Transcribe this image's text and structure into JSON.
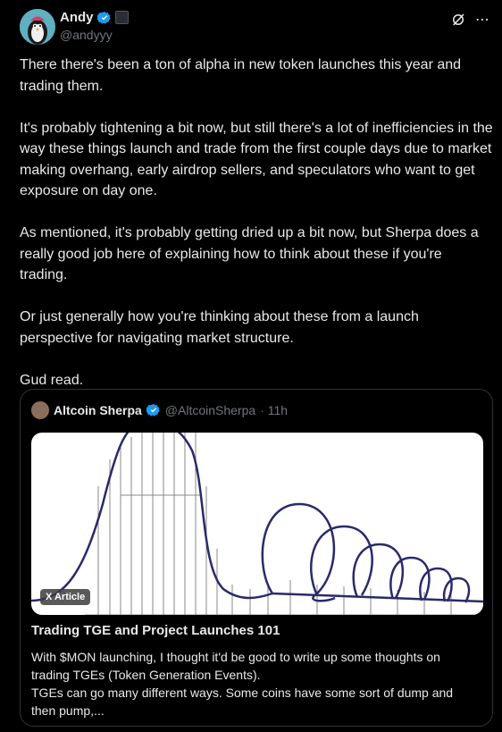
{
  "author": {
    "name": "Andy",
    "handle": "@andyyy"
  },
  "post": {
    "paragraphs": [
      "There there's been a ton of alpha in new token launches this year and trading them.",
      "It's probably tightening a bit now, but still there's a lot of inefficiencies in the way these things launch and trade from the first couple days due to market making overhang, early airdrop sellers, and speculators who want to get exposure on day one.",
      "As mentioned, it's probably getting dried up a bit now, but Sherpa does a really good job here of explaining how to think about these if you're trading.",
      "Or just generally how you're thinking about these from a launch perspective for navigating market structure.",
      "Gud read."
    ]
  },
  "quote": {
    "name": "Altcoin Sherpa",
    "handle": "@AltcoinSherpa",
    "time": "· 11h",
    "badge": "X Article",
    "title": "Trading TGE and Project Launches 101",
    "desc_line1": "With $MON launching, I thought it'd be good to write up some thoughts on trading TGEs (Token Generation Events).",
    "desc_line2": "TGEs can go many different ways. Some coins have some sort of dump and then pump,..."
  },
  "colors": {
    "background": "#000000",
    "verified": "#1d9bf0",
    "muted": "#71767b"
  }
}
